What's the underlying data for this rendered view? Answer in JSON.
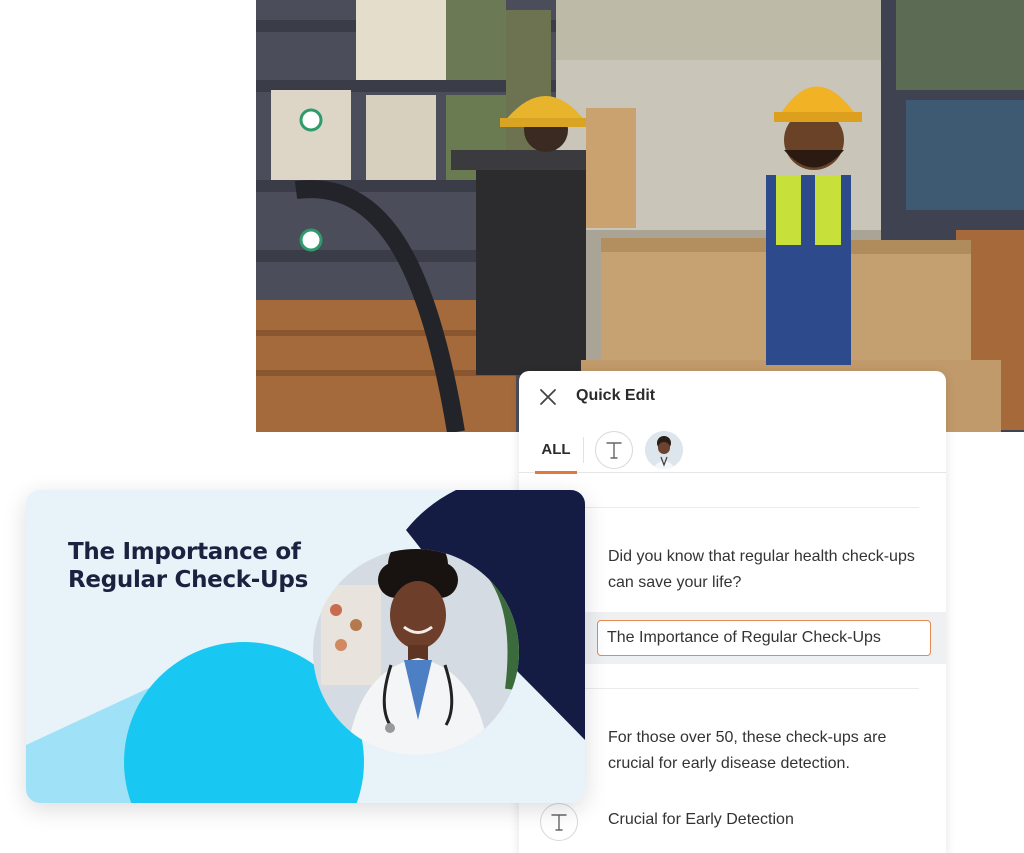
{
  "panel": {
    "title": "Quick Edit",
    "close_icon": "close-icon",
    "tabs": [
      {
        "label": "ALL",
        "active": true
      },
      {
        "icon": "text-type-icon"
      },
      {
        "icon": "image-thumbnail-icon"
      }
    ],
    "items": [
      {
        "type": "text",
        "value": "Did you know that regular health check-ups can save your life?"
      },
      {
        "type": "input",
        "value": "The Importance of Regular Check-Ups",
        "focused": true
      },
      {
        "type": "text",
        "value": "For those over 50, these check-ups are crucial for early disease detection."
      },
      {
        "type": "text",
        "value": "Crucial for Early Detection",
        "icon": "text-type-icon"
      }
    ]
  },
  "slide": {
    "title": "The Importance of Regular Check-Ups"
  },
  "colors": {
    "accent": "#e07840",
    "slide_navy": "#1a2240",
    "slide_cyan": "#19c8f2",
    "slide_bg": "#e7f3f9"
  }
}
